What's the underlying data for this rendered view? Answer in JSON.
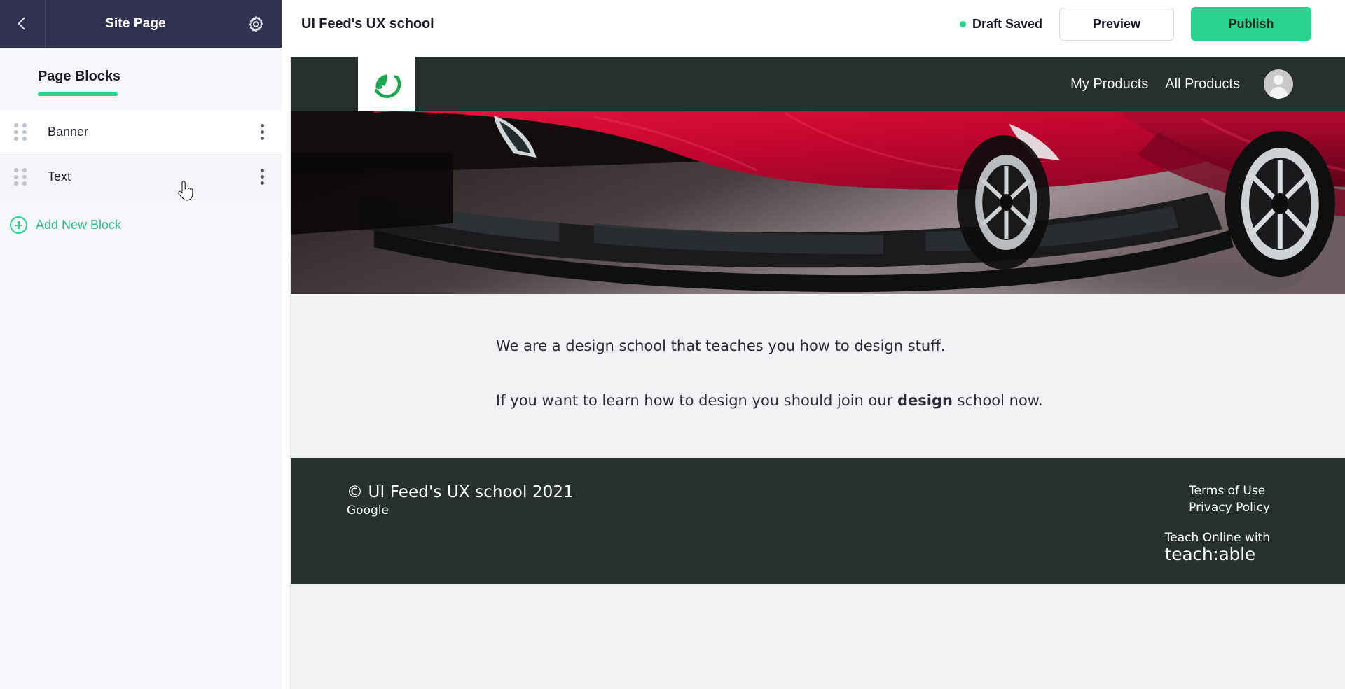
{
  "topbar": {
    "back_icon": "chevron-left-icon",
    "panel_title": "Site Page",
    "settings_icon": "gear-icon",
    "page_title": "UI Feed's UX school",
    "draft_status": "Draft Saved",
    "draft_dot_color": "#2ed18a",
    "preview_label": "Preview",
    "publish_label": "Publish",
    "publish_color": "#2ad490"
  },
  "sidebar": {
    "section_title": "Page Blocks",
    "accent_color": "#2ed18a",
    "blocks": [
      {
        "label": "Banner",
        "drag_icon": "drag-handle-icon",
        "menu_icon": "kebab-menu-icon",
        "state": "default"
      },
      {
        "label": "Text",
        "drag_icon": "drag-handle-icon",
        "menu_icon": "kebab-menu-icon",
        "state": "hovered"
      }
    ],
    "add_block": {
      "label": "Add New Block",
      "icon": "plus-circle-icon"
    }
  },
  "preview": {
    "site_header": {
      "logo_icon": "green-leaf-recycle-check-logo",
      "logo_color": "#20a64f",
      "background": "#26302f",
      "nav": [
        {
          "label": "My Products"
        },
        {
          "label": "All Products"
        }
      ],
      "avatar_icon": "user-avatar-icon"
    },
    "hero": {
      "image_alt": "Red sports car front view in dark studio",
      "car_color": "#c8102e",
      "background": "#1a1413"
    },
    "text_block": {
      "paragraph_1": "We are a design school that teaches you how to design stuff.",
      "paragraph_2_before": "If you want to learn how to design you should join our ",
      "paragraph_2_bold": "design",
      "paragraph_2_after": " school now.",
      "background": "#f2f2f5"
    },
    "footer": {
      "copyright": "© UI Feed's UX school 2021",
      "subline": "Google",
      "links": [
        {
          "label": "Terms of Use"
        },
        {
          "label": "Privacy Policy"
        }
      ],
      "teach_label": "Teach Online with",
      "teach_brand": "teach:able",
      "background": "#26302f"
    }
  },
  "cursor": {
    "icon": "pointer-hand-cursor"
  }
}
